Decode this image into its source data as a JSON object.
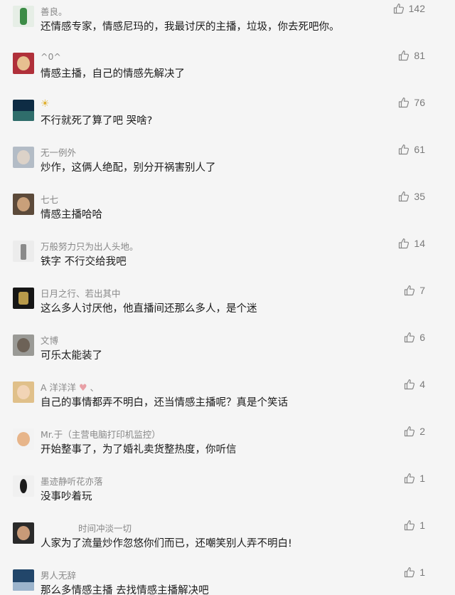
{
  "comments": [
    {
      "user": "善良。",
      "text": "还情感专家，情感尼玛的，我最讨厌的主播，垃圾，你去死吧你。",
      "likes": "142",
      "avatar": [
        "#e6eee6",
        "#3c8c46"
      ]
    },
    {
      "user": "^0^",
      "text": "情感主播，自己的情感先解决了",
      "likes": "81",
      "avatar": [
        "#b0303a",
        "#e7c090"
      ]
    },
    {
      "user": "",
      "text": "不行就死了算了吧 哭啥?",
      "likes": "76",
      "avatar": [
        "#0e2c44",
        "#2f6d6b"
      ],
      "user_icon": "☀"
    },
    {
      "user": "无一例外",
      "text": "炒作，这俩人绝配，别分开祸害别人了",
      "likes": "61",
      "avatar": [
        "#b3bcc6",
        "#dcd2c8"
      ]
    },
    {
      "user": "七七",
      "text": "情感主播哈哈",
      "likes": "35",
      "avatar": [
        "#5c4a3a",
        "#c9a07a"
      ]
    },
    {
      "user": "万般努力只为出人头地。",
      "text": "铁字 不行交给我吧",
      "likes": "14",
      "avatar": [
        "#ececec",
        "#8a8a8a"
      ]
    },
    {
      "user": "日月之行、若出其中",
      "text": "这么多人讨厌他，他直播间还那么多人，是个迷",
      "likes": "7",
      "avatar": [
        "#161616",
        "#b89a4a"
      ]
    },
    {
      "user": "文博",
      "text": "可乐太能装了",
      "likes": "6",
      "avatar": [
        "#9a9a96",
        "#6d6257"
      ]
    },
    {
      "user": "A 洋洋洋",
      "text": "自己的事情都弄不明白，还当情感主播呢？真是个笑话",
      "likes": "4",
      "avatar": [
        "#e0c08a",
        "#f2d4b6"
      ],
      "user_suffix": " 、"
    },
    {
      "user": "Mr.于（主营电脑打印机监控）",
      "text": "开始整事了，为了婚礼卖货整热度，你听信",
      "likes": "2",
      "avatar": [
        "#f3f3f3",
        "#e7b58a"
      ]
    },
    {
      "user": "墨迹静听花亦落",
      "text": "没事吵着玩",
      "likes": "1",
      "avatar": [
        "#f0f0f0",
        "#1c1c1c"
      ]
    },
    {
      "user": "时间冲淡一切",
      "text": "人家为了流量炒作忽悠你们而已，还嘲笑别人弄不明白!",
      "likes": "1",
      "avatar": [
        "#2a2a2a",
        "#c89a78"
      ],
      "user_pad": true
    },
    {
      "user": "男人无辞",
      "text": "那么多情感主播 去找情感主播解决吧",
      "likes": "1",
      "avatar": [
        "#22466a",
        "#9cb4cc"
      ]
    }
  ],
  "like_icon": "thumbs-up-icon",
  "colors": {
    "text": "#1a1a1a",
    "username": "#888888",
    "count": "#7a7a7a",
    "background": "#f5f5f5",
    "heart": "#e8a0a6"
  }
}
